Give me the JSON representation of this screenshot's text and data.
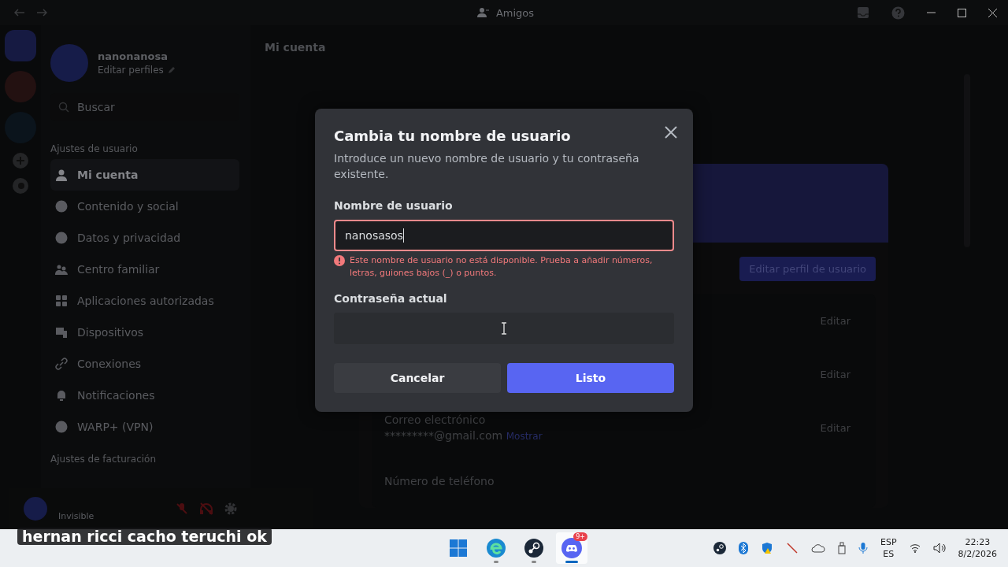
{
  "titlebar": {
    "title": "Amigos"
  },
  "sidebar": {
    "user": {
      "name": "nanonanosa",
      "subtitle": "Editar perfiles"
    },
    "search": {
      "placeholder": "Buscar"
    },
    "sections": [
      {
        "heading": "Ajustes de usuario",
        "items": [
          {
            "label": "Mi cuenta",
            "selected": true
          },
          {
            "label": "Contenido y social",
            "selected": false
          },
          {
            "label": "Datos y privacidad",
            "selected": false
          },
          {
            "label": "Centro familiar",
            "selected": false
          },
          {
            "label": "Aplicaciones autorizadas",
            "selected": false
          },
          {
            "label": "Dispositivos",
            "selected": false
          },
          {
            "label": "Conexiones",
            "selected": false
          },
          {
            "label": "Notificaciones",
            "selected": false
          },
          {
            "label": "WARP+ (VPN)",
            "selected": false
          }
        ]
      },
      {
        "heading": "Ajustes de facturación"
      }
    ]
  },
  "user_panel": {
    "status": "Invisible",
    "mic_muted": true,
    "sound_muted": true
  },
  "page": {
    "title": "Mi cuenta",
    "edit_profile_button": "Editar perfil de usuario",
    "rows": [
      {
        "action": "Editar"
      },
      {
        "action": "Editar"
      },
      {
        "label": "Correo electrónico",
        "value": "*********@gmail.com",
        "reveal": "Mostrar",
        "action": "Editar"
      },
      {
        "label": "Número de teléfono"
      }
    ]
  },
  "modal": {
    "title": "Cambia tu nombre de usuario",
    "description": "Introduce un nuevo nombre de usuario y tu contraseña existente.",
    "username": {
      "label": "Nombre de usuario",
      "value": "nanosasos",
      "error": "Este nombre de usuario no está disponible. Prueba a añadir números, letras, guiones bajos (_) o puntos."
    },
    "password": {
      "label": "Contraseña actual"
    },
    "cancel": "Cancelar",
    "confirm": "Listo"
  },
  "chat_overlay": "hernan ricci cacho teruchi ok",
  "taskbar": {
    "apps": [
      {
        "kind": "start",
        "running": false,
        "selected": false
      },
      {
        "kind": "edge",
        "running": true,
        "selected": false
      },
      {
        "kind": "steam",
        "running": true,
        "selected": false
      },
      {
        "kind": "discord",
        "running": true,
        "selected": true,
        "badge": "9+"
      }
    ],
    "language": "ESP",
    "layout": "ES",
    "time": "22:23",
    "date": "8/2/2026"
  }
}
